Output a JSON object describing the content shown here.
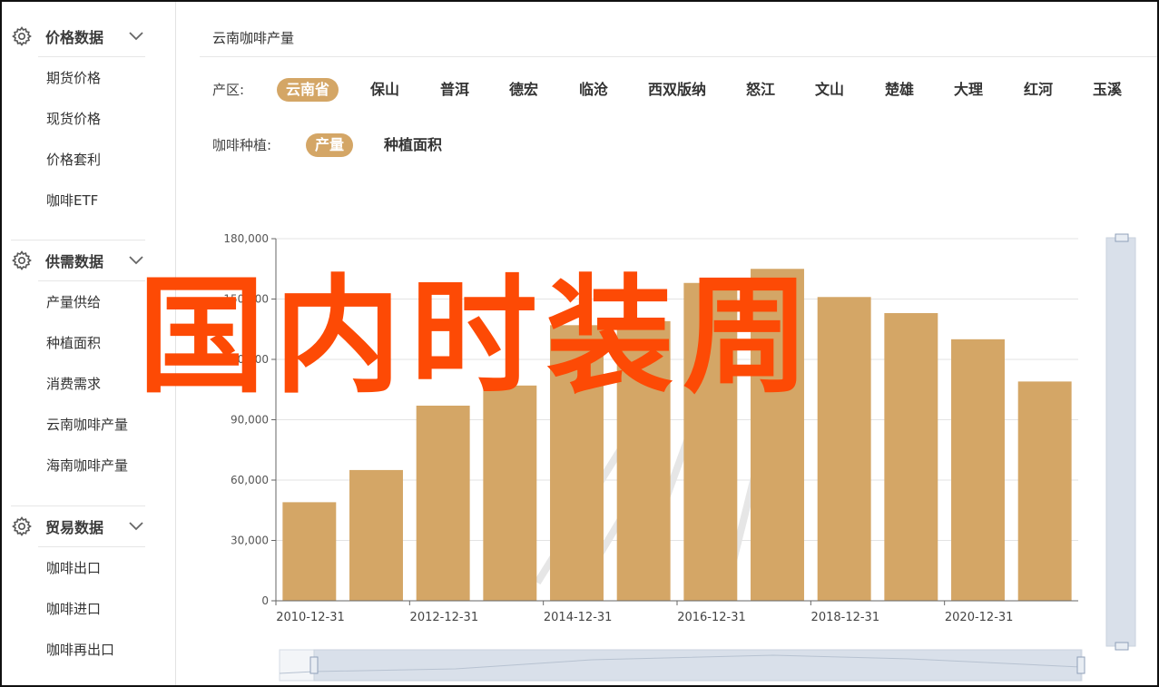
{
  "sidebar": {
    "groups": [
      {
        "title": "价格数据",
        "items": [
          "期货价格",
          "现货价格",
          "价格套利",
          "咖啡ETF"
        ]
      },
      {
        "title": "供需数据",
        "items": [
          "产量供给",
          "种植面积",
          "消费需求",
          "云南咖啡产量",
          "海南咖啡产量"
        ]
      },
      {
        "title": "贸易数据",
        "items": [
          "咖啡出口",
          "咖啡进口",
          "咖啡再出口"
        ]
      }
    ]
  },
  "main": {
    "title": "云南咖啡产量",
    "region_label": "产区:",
    "regions": [
      "云南省",
      "保山",
      "普洱",
      "德宏",
      "临沧",
      "西双版纳",
      "怒江",
      "文山",
      "楚雄",
      "大理",
      "红河",
      "玉溪"
    ],
    "active_region": "云南省",
    "planting_label": "咖啡种植:",
    "planting_options": [
      "产量",
      "种植面积"
    ],
    "active_planting": "产量"
  },
  "watermark": "国内时装周",
  "colors": {
    "accent": "#d4a666",
    "bar": "#d4a666",
    "watermark": "#fd4a05",
    "slider": "#d9e0ea"
  },
  "chart_data": {
    "type": "bar",
    "categories": [
      "2010-12-31",
      "2011-12-31",
      "2012-12-31",
      "2013-12-31",
      "2014-12-31",
      "2015-12-31",
      "2016-12-31",
      "2017-12-31",
      "2018-12-31",
      "2019-12-31",
      "2020-12-31",
      "2021-12-31"
    ],
    "x_tick_labels": [
      "2010-12-31",
      "2012-12-31",
      "2014-12-31",
      "2016-12-31",
      "2018-12-31",
      "2020-12-31"
    ],
    "values": [
      49000,
      65000,
      97000,
      107000,
      137000,
      139000,
      158000,
      165000,
      151000,
      143000,
      130000,
      109000
    ],
    "y_ticks": [
      "0",
      "30,000",
      "60,000",
      "90,000",
      "120,000",
      "150,000",
      "180,000"
    ],
    "ylim": [
      0,
      180000
    ],
    "grid": true,
    "legend": "none"
  }
}
